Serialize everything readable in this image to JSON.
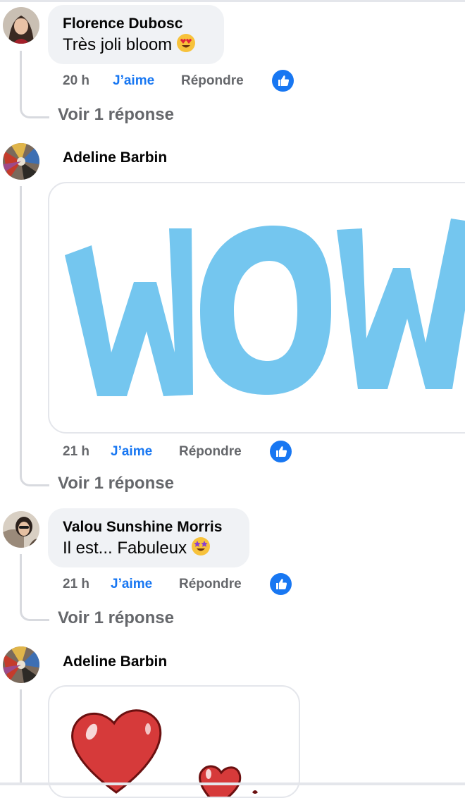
{
  "comments": [
    {
      "author": "Florence Dubosc",
      "text": "Très joli bloom",
      "emoji_icon": "heart-eyes-emoji",
      "time": "20 h",
      "like_label": "J’aime",
      "reply_label": "Répondre",
      "replies_label": "Voir 1 réponse"
    },
    {
      "author": "Adeline Barbin",
      "sticker": "wow-sticker",
      "time": "21 h",
      "like_label": "J’aime",
      "reply_label": "Répondre",
      "replies_label": "Voir 1 réponse"
    },
    {
      "author": "Valou Sunshine Morris",
      "text": "Il est... Fabuleux",
      "emoji_icon": "star-struck-emoji",
      "time": "21 h",
      "like_label": "J’aime",
      "reply_label": "Répondre",
      "replies_label": "Voir 1 réponse"
    },
    {
      "author": "Adeline Barbin",
      "sticker": "hearts-sticker"
    }
  ],
  "colors": {
    "like_blue": "#1877f2",
    "bubble_gray": "#f0f2f5",
    "meta_gray": "#65676b",
    "sticker_wow": "#74c6ef"
  }
}
